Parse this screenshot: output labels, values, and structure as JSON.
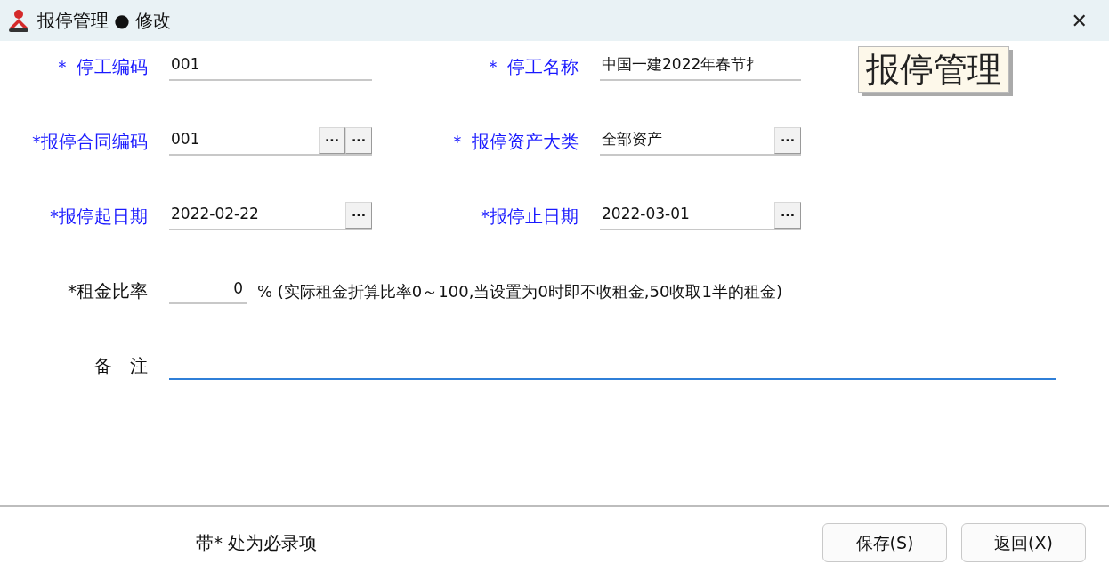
{
  "window": {
    "title": "报停管理 ● 修改",
    "close": "✕"
  },
  "rows": [
    {
      "fields": [
        {
          "label": "＊ 停工编码",
          "emphasis": true,
          "value": "001"
        },
        {
          "label": "＊ 停工名称",
          "emphasis": true,
          "value": "中国一建2022年春节扌"
        }
      ]
    },
    {
      "fields": [
        {
          "label": "*报停合同编码",
          "emphasis": true,
          "value": "001",
          "buttons": [
            "···",
            "···"
          ]
        },
        {
          "label": "＊ 报停资产大类",
          "emphasis": true,
          "value": "全部资产",
          "buttons": [
            "···"
          ]
        }
      ]
    },
    {
      "fields": [
        {
          "label": "*报停起日期",
          "emphasis": true,
          "value": "2022-02-22",
          "buttons": [
            "···"
          ]
        },
        {
          "label": "*报停止日期",
          "emphasis": true,
          "value": "2022-03-01",
          "buttons": [
            "···"
          ]
        }
      ]
    }
  ],
  "stamp": "报停管理",
  "rent": {
    "label": "*租金比率",
    "emphasis": false,
    "value": "0",
    "note": "% (实际租金折算比率0～100,当设置为0时即不收租金,50收取1半的租金)"
  },
  "remark": {
    "label": "备　注",
    "emphasis": false,
    "focused": true
  },
  "footer": {
    "hint": "带* 处为必录项",
    "buttons": [
      "保存(S)",
      "返回(X)"
    ]
  }
}
